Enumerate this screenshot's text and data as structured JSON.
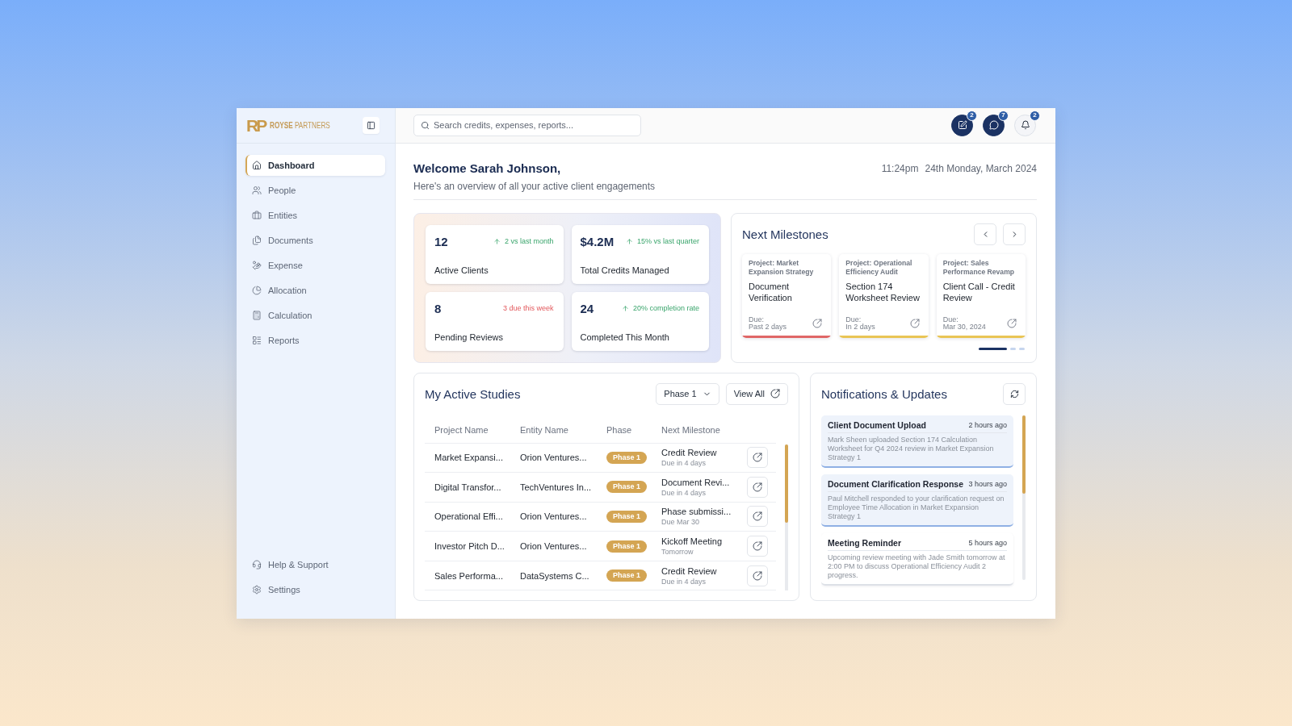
{
  "brand": {
    "monogram": "RP",
    "name": "**ROYSE** PARTNERS"
  },
  "sidebar": {
    "items": [
      {
        "label": "Dashboard",
        "selected": true
      },
      {
        "label": "People",
        "selected": false
      },
      {
        "label": "Entities",
        "selected": false
      },
      {
        "label": "Documents",
        "selected": false
      },
      {
        "label": "Expense",
        "selected": false
      },
      {
        "label": "Allocation",
        "selected": false
      },
      {
        "label": "Calculation",
        "selected": false
      },
      {
        "label": "Reports",
        "selected": false
      }
    ],
    "footer_items": [
      {
        "label": "Help & Support",
        "selected": false
      },
      {
        "label": "Settings",
        "selected": false
      }
    ]
  },
  "header": {
    "search": {
      "placeholder": "Search credits, expenses, reports..."
    },
    "actions": [
      {
        "kind": "filled",
        "badge": "2"
      },
      {
        "kind": "filled",
        "badge": "7"
      },
      {
        "kind": "plain",
        "badge": "2"
      }
    ]
  },
  "welcome": {
    "title": "Welcome Sarah Johnson,",
    "subtitle": "Here's an overview of all your active client engagements",
    "time": "11:24pm",
    "date": "24th Monday, March 2024"
  },
  "stats": [
    {
      "value": "12",
      "kind": "up",
      "trend": "2 vs last month",
      "label": "Active Clients"
    },
    {
      "value": "$4.2M",
      "kind": "up",
      "trend": "15% vs last quarter",
      "label": "Total Credits Managed"
    },
    {
      "value": "8",
      "kind": "alert",
      "trend": "3 due this week",
      "label": "Pending Reviews"
    },
    {
      "value": "24",
      "kind": "up",
      "trend": "20% completion rate",
      "label": "Completed This Month"
    }
  ],
  "milestones": {
    "title": "Next Milestones",
    "items": [
      {
        "project": "Project: Market Expansion Strategy",
        "title": "Document Verification",
        "due_label": "Due:",
        "due": "Past 2 days",
        "color": "#e06767"
      },
      {
        "project": "Project: Operational Efficiency Audit",
        "title": "Section 174 Worksheet Review",
        "due_label": "Due:",
        "due": "In 2 days",
        "color": "#e9c555"
      },
      {
        "project": "Project: Sales Performance Revamp",
        "title": "Client Call - Credit Review",
        "due_label": "Due:",
        "due": "Mar 30, 2024",
        "color": "#e9c555"
      }
    ],
    "pages": [
      {
        "selected": true
      },
      {
        "selected": false
      },
      {
        "selected": false
      }
    ]
  },
  "active_studies": {
    "title": "My Active Studies",
    "filter": "Phase 1",
    "view_all": "View All",
    "columns": [
      "Project Name",
      "Entity Name",
      "Phase",
      "Next Milestone"
    ],
    "rows": [
      {
        "project": "Market Expansi...",
        "entity": "Orion Ventures...",
        "phase": "Phase 1",
        "milestone": "Credit Review",
        "due": "Due in 4 days"
      },
      {
        "project": "Digital Transfor...",
        "entity": "TechVentures In...",
        "phase": "Phase 1",
        "milestone": "Document Revi...",
        "due": "Due in 4 days"
      },
      {
        "project": "Operational Effi...",
        "entity": "Orion Ventures...",
        "phase": "Phase 1",
        "milestone": "Phase submissi...",
        "due": "Due Mar 30"
      },
      {
        "project": "Investor Pitch D...",
        "entity": "Orion Ventures...",
        "phase": "Phase 1",
        "milestone": "Kickoff Meeting",
        "due": "Tomorrow"
      },
      {
        "project": "Sales Performa...",
        "entity": "DataSystems C...",
        "phase": "Phase 1",
        "milestone": "Credit Review",
        "due": "Due in 4 days"
      }
    ]
  },
  "notifications": {
    "title": "Notifications & Updates",
    "items": [
      {
        "title": "Client Document Upload",
        "time": "2 hours ago",
        "body": "Mark Sheen uploaded Section 174 Calculation Worksheet for Q4 2024 review in Market Expansion Strategy 1",
        "unread": true
      },
      {
        "title": "Document Clarification Response",
        "time": "3 hours ago",
        "body": "Paul Mitchell responded to your clarification request on Employee Time Allocation in Market Expansion Strategy 1",
        "unread": true
      },
      {
        "title": "Meeting Reminder",
        "time": "5 hours ago",
        "body": "Upcoming review meeting with Jade Smith tomorrow at 2:00 PM to discuss Operational Efficiency Audit 2 progress.",
        "unread": false
      }
    ]
  }
}
